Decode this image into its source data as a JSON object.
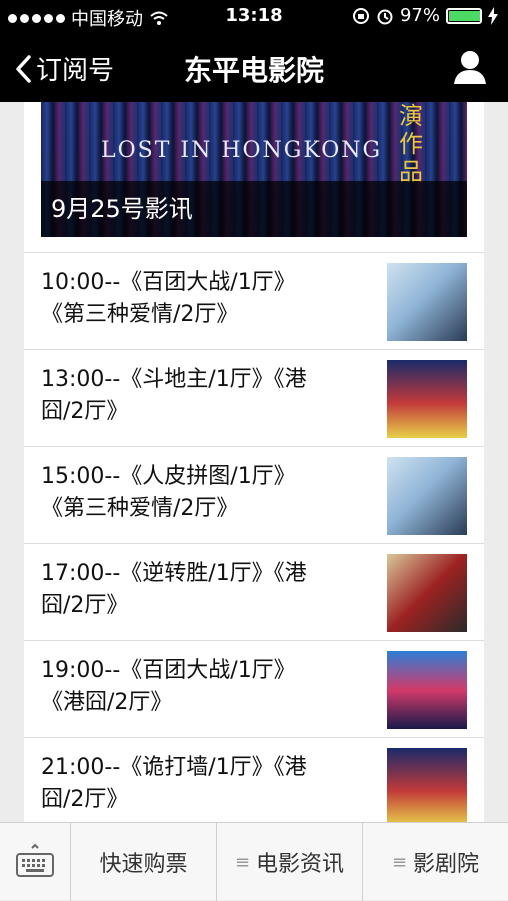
{
  "status_bar": {
    "carrier": "中国移动",
    "time": "13:18",
    "battery": "97%",
    "battery_level": 0.97
  },
  "nav": {
    "back_label": "订阅号",
    "title": "东平电影院"
  },
  "banner": {
    "poster_text": "LOST IN HONGKONG",
    "poster_cn": "演作品",
    "caption": "9月25号影讯"
  },
  "schedule": [
    {
      "line1": "10:00--《百团大战/1厅》",
      "line2": "《第三种爱情/2厅》",
      "thumb": "love"
    },
    {
      "line1": "13:00--《斗地主/1厅》《港",
      "line2": "囧/2厅》",
      "thumb": "hk"
    },
    {
      "line1": "15:00--《人皮拼图/1厅》",
      "line2": "《第三种爱情/2厅》",
      "thumb": "love"
    },
    {
      "line1": "17:00--《逆转胜/1厅》《港",
      "line2": "囧/2厅》",
      "thumb": "bw"
    },
    {
      "line1": "19:00--《百团大战/1厅》",
      "line2": "《港囧/2厅》",
      "thumb": "blue"
    },
    {
      "line1": "21:00--《诡打墙/1厅》《港",
      "line2": "囧/2厅》",
      "thumb": "hk"
    }
  ],
  "tabbar": {
    "tab1": "快速购票",
    "tab2": "电影资讯",
    "tab3": "影剧院"
  },
  "icons": [
    "signal-dots-icon",
    "wifi-icon",
    "orientation-lock-icon",
    "alarm-icon",
    "battery-icon",
    "charging-icon",
    "back-chevron-icon",
    "user-icon",
    "keyboard-icon",
    "menu-icon"
  ]
}
